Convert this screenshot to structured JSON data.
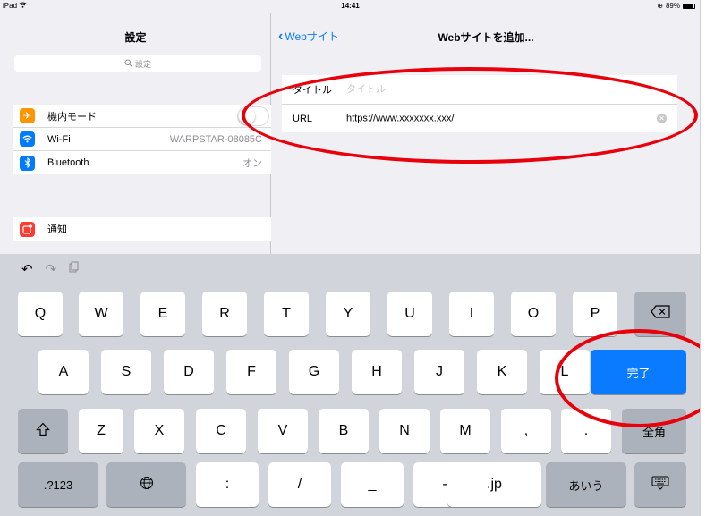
{
  "status_bar": {
    "device": "iPad",
    "time": "14:41",
    "battery": "89%",
    "battery_level": 0.89
  },
  "sidebar": {
    "title": "設定",
    "search_placeholder": "設定",
    "items": [
      {
        "label": "機内モード",
        "value": "",
        "icon": "airplane-icon",
        "color": "#ff9500"
      },
      {
        "label": "Wi-Fi",
        "value": "WARPSTAR-08085C",
        "icon": "wifi-icon",
        "color": "#007aff"
      },
      {
        "label": "Bluetooth",
        "value": "オン",
        "icon": "bluetooth-icon",
        "color": "#007aff"
      }
    ],
    "items2": [
      {
        "label": "通知",
        "icon": "notification-icon",
        "color": "#ff3b30"
      }
    ]
  },
  "detail": {
    "back_label": "Webサイト",
    "title": "Webサイトを追加...",
    "fields": {
      "title_label": "タイトル",
      "title_placeholder": "タイトル",
      "url_label": "URL",
      "url_value": "https://www.xxxxxxx.xxx/"
    }
  },
  "keyboard": {
    "shortcuts": [
      "undo-icon",
      "redo-icon",
      "paste-icon"
    ],
    "rows": [
      [
        "Q",
        "W",
        "E",
        "R",
        "T",
        "Y",
        "U",
        "I",
        "O",
        "P"
      ],
      [
        "A",
        "S",
        "D",
        "F",
        "G",
        "H",
        "J",
        "K",
        "L"
      ],
      [
        "Z",
        "X",
        "C",
        "V",
        "B",
        "N",
        "M",
        ",",
        "."
      ]
    ],
    "done_label": "完了",
    "zenkaku_label": "全角",
    "bottom_row": [
      ".?123",
      ":",
      "/",
      "_",
      "-",
      ".jp",
      "あいう"
    ],
    "accent_color": "#0a7aff",
    "annotation_color": "#e8000b"
  }
}
